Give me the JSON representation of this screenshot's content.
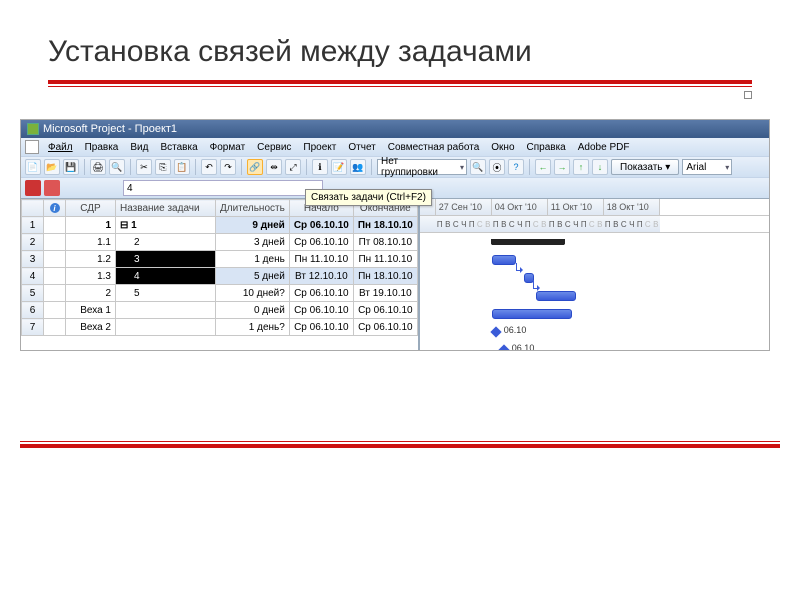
{
  "slide": {
    "title": "Установка связей между задачами"
  },
  "app": {
    "title": "Microsoft Project - Проект1",
    "menu": [
      "Файл",
      "Правка",
      "Вид",
      "Вставка",
      "Формат",
      "Сервис",
      "Проект",
      "Отчет",
      "Совместная работа",
      "Окно",
      "Справка",
      "Adobe PDF"
    ],
    "group_combo": "Нет группировки",
    "show_btn": "Показать ▾",
    "font_combo": "Arial",
    "entry_value": "4",
    "tooltip": "Связать задачи (Ctrl+F2)"
  },
  "columns": [
    "",
    "",
    "СДР",
    "Название задачи",
    "Длительность",
    "Начало",
    "Окончание"
  ],
  "rows": [
    {
      "n": "1",
      "sdr": "1",
      "name": "⊟ 1",
      "dur": "9 дней",
      "start": "Ср 06.10.10",
      "end": "Пн 18.10.10",
      "bold": true,
      "blue": true
    },
    {
      "n": "2",
      "sdr": "1.1",
      "name": "2",
      "dur": "3 дней",
      "start": "Ср 06.10.10",
      "end": "Пт 08.10.10"
    },
    {
      "n": "3",
      "sdr": "1.2",
      "name": "3",
      "dur": "1 день",
      "start": "Пн 11.10.10",
      "end": "Пн 11.10.10",
      "sel": true
    },
    {
      "n": "4",
      "sdr": "1.3",
      "name": "4",
      "dur": "5 дней",
      "start": "Вт 12.10.10",
      "end": "Пн 18.10.10",
      "sel": true,
      "blue": true
    },
    {
      "n": "5",
      "sdr": "2",
      "name": "5",
      "dur": "10 дней?",
      "start": "Ср 06.10.10",
      "end": "Вт 19.10.10"
    },
    {
      "n": "6",
      "sdr": "Веха 1",
      "name": "",
      "dur": "0 дней",
      "start": "Ср 06.10.10",
      "end": "Ср 06.10.10"
    },
    {
      "n": "7",
      "sdr": "Веха 2",
      "name": "",
      "dur": "1 день?",
      "start": "Ср 06.10.10",
      "end": "Ср 06.10.10"
    }
  ],
  "weeks": [
    "27 Сен '10",
    "04 Окт '10",
    "11 Окт '10",
    "18 Окт '10"
  ],
  "days": [
    "П",
    "В",
    "С",
    "Ч",
    "П",
    "С",
    "В"
  ],
  "milestone_label": "06.10"
}
